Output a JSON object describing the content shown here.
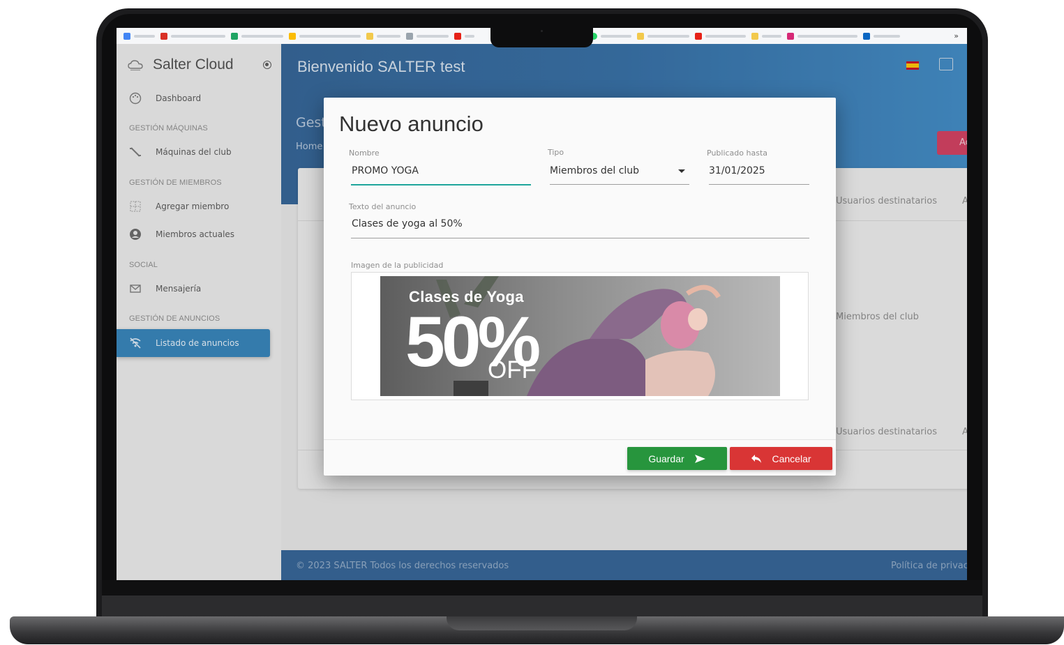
{
  "sidebar": {
    "brand": "Salter Cloud",
    "dashboard": "Dashboard",
    "sec_machines": "GESTIÓN MÁQUINAS",
    "machines": "Máquinas del club",
    "sec_members": "GESTIÓN DE MIEMBROS",
    "add_member": "Agregar miembro",
    "current_members": "Miembros actuales",
    "sec_social": "SOCIAL",
    "messaging": "Mensajería",
    "sec_ads": "GESTIÓN DE ANUNCIOS",
    "ad_list": "Listado de anuncios"
  },
  "header": {
    "welcome": "Bienvenido SALTER test"
  },
  "page": {
    "title_partial": "Gest",
    "crumb_partial": "Home",
    "add_button_partial": "Ac",
    "col_targets": "Usuarios destinatarios",
    "col_next_partial": "A",
    "cell_targets": "Miembros del club"
  },
  "footer": {
    "copyright": "© 2023 SALTER Todos los derechos reservados",
    "policy_partial": "Política de privac"
  },
  "modal": {
    "title": "Nuevo anuncio",
    "name_label": "Nombre",
    "name_value": "PROMO YOGA",
    "type_label": "Tipo",
    "type_value": "Miembros del club",
    "until_label": "Publicado hasta",
    "until_value": "31/01/2025",
    "text_label": "Texto del anuncio",
    "text_value": "Clases de yoga al 50%",
    "image_label": "Imagen de la publicidad",
    "save": "Guardar",
    "cancel": "Cancelar"
  },
  "promo_image": {
    "title": "Clases de Yoga",
    "big": "50%",
    "off": "OFF"
  },
  "colors": {
    "header_blue": "#2f6aa2",
    "active_item": "#2f80b8",
    "save_green": "#27953d",
    "cancel_red": "#d93535",
    "focus_teal": "#1ea59b"
  }
}
